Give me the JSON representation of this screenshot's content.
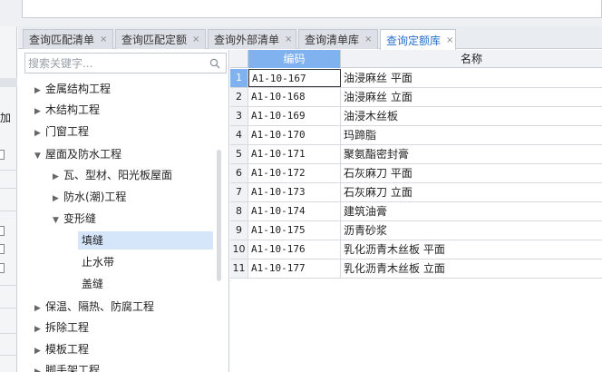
{
  "left_strip": {
    "label": "加"
  },
  "tabs": [
    {
      "label": "查询匹配清单",
      "close": "×",
      "active": false
    },
    {
      "label": "查询匹配定额",
      "close": "×",
      "active": false
    },
    {
      "label": "查询外部清单",
      "close": "×",
      "active": false
    },
    {
      "label": "查询清单库",
      "close": "×",
      "active": false
    },
    {
      "label": "查询定额库",
      "close": "×",
      "active": true
    }
  ],
  "search": {
    "placeholder": "搜索关键字..."
  },
  "tree": [
    {
      "label": "金属结构工程",
      "arrow": "▶",
      "level": 0
    },
    {
      "label": "木结构工程",
      "arrow": "▶",
      "level": 0
    },
    {
      "label": "门窗工程",
      "arrow": "▶",
      "level": 0
    },
    {
      "label": "屋面及防水工程",
      "arrow": "▼",
      "level": 0
    },
    {
      "label": "瓦、型材、阳光板屋面",
      "arrow": "▶",
      "level": 1
    },
    {
      "label": "防水(潮)工程",
      "arrow": "▶",
      "level": 1
    },
    {
      "label": "变形缝",
      "arrow": "▼",
      "level": 1
    },
    {
      "label": "填缝",
      "arrow": "",
      "level": 2,
      "selected": true
    },
    {
      "label": "止水带",
      "arrow": "",
      "level": 2
    },
    {
      "label": "盖缝",
      "arrow": "",
      "level": 2
    },
    {
      "label": "保温、隔热、防腐工程",
      "arrow": "▶",
      "level": 0
    },
    {
      "label": "拆除工程",
      "arrow": "▶",
      "level": 0
    },
    {
      "label": "模板工程",
      "arrow": "▶",
      "level": 0
    },
    {
      "label": "脚手架工程",
      "arrow": "▶",
      "level": 0
    }
  ],
  "table": {
    "headers": {
      "code": "编码",
      "name": "名称"
    },
    "rows": [
      {
        "idx": "1",
        "code": "A1-10-167",
        "name": "油浸麻丝 平面"
      },
      {
        "idx": "2",
        "code": "A1-10-168",
        "name": "油浸麻丝 立面"
      },
      {
        "idx": "3",
        "code": "A1-10-169",
        "name": "油浸木丝板"
      },
      {
        "idx": "4",
        "code": "A1-10-170",
        "name": "玛蹄脂"
      },
      {
        "idx": "5",
        "code": "A1-10-171",
        "name": "聚氨酯密封膏"
      },
      {
        "idx": "6",
        "code": "A1-10-172",
        "name": "石灰麻刀 平面"
      },
      {
        "idx": "7",
        "code": "A1-10-173",
        "name": "石灰麻刀 立面"
      },
      {
        "idx": "8",
        "code": "A1-10-174",
        "name": "建筑油膏"
      },
      {
        "idx": "9",
        "code": "A1-10-175",
        "name": "沥青砂浆"
      },
      {
        "idx": "10",
        "code": "A1-10-176",
        "name": "乳化沥青木丝板 平面"
      },
      {
        "idx": "11",
        "code": "A1-10-177",
        "name": "乳化沥青木丝板 立面"
      }
    ]
  },
  "colors": {
    "accent": "#2a6fc9",
    "header_highlight": "#7fb2ee",
    "selected_row": "#d5e6fb"
  }
}
